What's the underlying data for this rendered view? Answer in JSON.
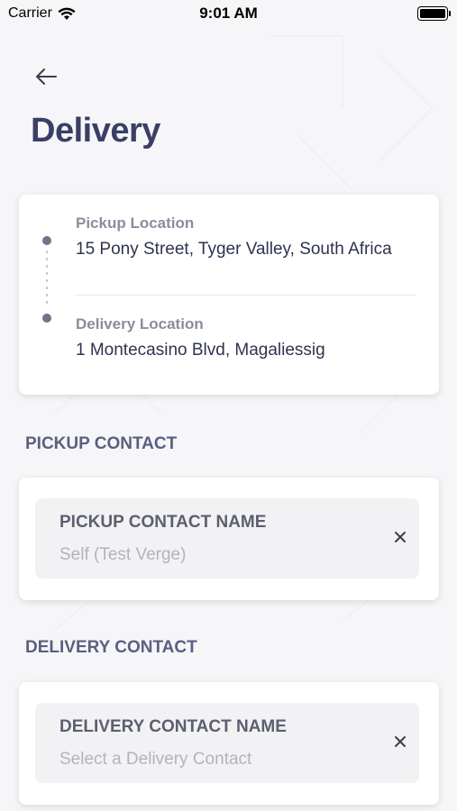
{
  "status_bar": {
    "carrier": "Carrier",
    "time": "9:01 AM",
    "icons": [
      "wifi-icon",
      "battery-icon"
    ]
  },
  "header": {
    "back_icon": "arrow-left-icon",
    "title": "Delivery"
  },
  "route": {
    "pickup_label": "Pickup Location",
    "pickup_value": "15 Pony Street, Tyger Valley, South Africa",
    "delivery_label": "Delivery Location",
    "delivery_value": "1 Montecasino Blvd, Magaliessig"
  },
  "pickup_contact": {
    "heading": "PICKUP CONTACT",
    "field_label": "PICKUP CONTACT NAME",
    "field_value": "Self (Test Verge)",
    "clear_icon": "close-icon"
  },
  "delivery_contact": {
    "heading": "DELIVERY CONTACT",
    "field_label": "DELIVERY CONTACT NAME",
    "field_placeholder": "Select a Delivery Contact",
    "clear_icon": "close-icon"
  },
  "colors": {
    "title": "#3a3f66",
    "heading": "#5a5f80",
    "background": "#f6f6f8"
  }
}
